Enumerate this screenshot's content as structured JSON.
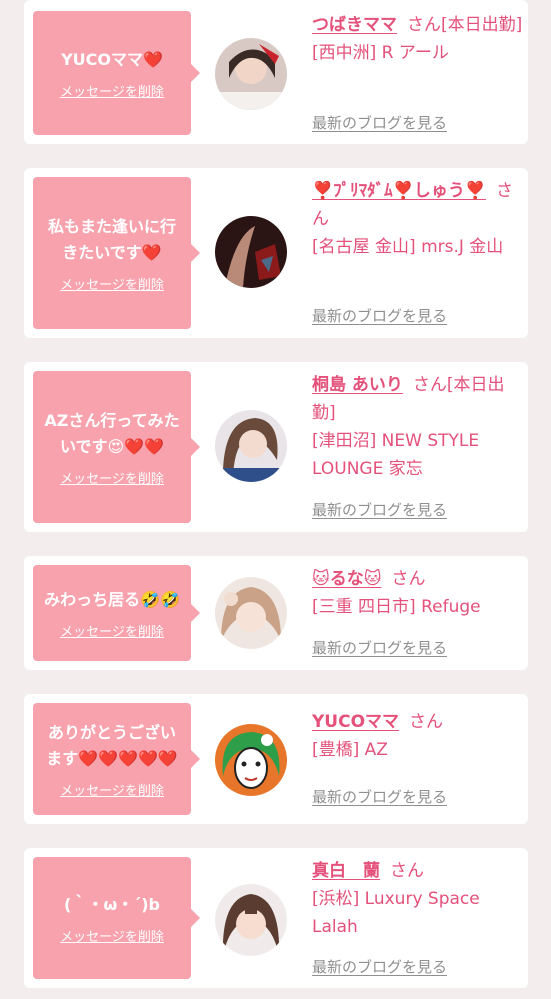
{
  "delete_label": "メッセージを削除",
  "blog_label": "最新のブログを見る",
  "san_label": "さん",
  "colors": {
    "bubble": "#f7a2ad",
    "accent": "#e4517a",
    "link_gray": "#8f8f8f"
  },
  "cards": [
    {
      "message": "YUCOママ❤️",
      "name": "つばきママ",
      "status": "[本日出勤]",
      "area": "[西中洲]",
      "shop": "R アール"
    },
    {
      "message": "私もまた逢いに行きたいです❤️",
      "name": "❣️ﾌﾟﾘﾏﾀﾞﾑ❣️しゅう❣️",
      "status": "",
      "area": "[名古屋 金山]",
      "shop": "mrs.J 金山"
    },
    {
      "message": "AZさん行ってみたいです😍❤️❤️",
      "name": "桐島 あいり",
      "status": "[本日出勤]",
      "area": "[津田沼]",
      "shop": "NEW STYLE LOUNGE 家忘"
    },
    {
      "message": "みわっち居る🤣🤣",
      "name": "🐱るな🐱",
      "status": "",
      "area": "[三重 四日市]",
      "shop": "Refuge"
    },
    {
      "message": "ありがとうございます❤️❤️❤️❤️❤️",
      "name": "YUCOママ",
      "status": "",
      "area": "[豊橋]",
      "shop": "AZ"
    },
    {
      "message": "(｀・ω・´)b",
      "name": "真白　蘭",
      "status": "",
      "area": "[浜松]",
      "shop": "Luxury Space Lalah"
    }
  ]
}
